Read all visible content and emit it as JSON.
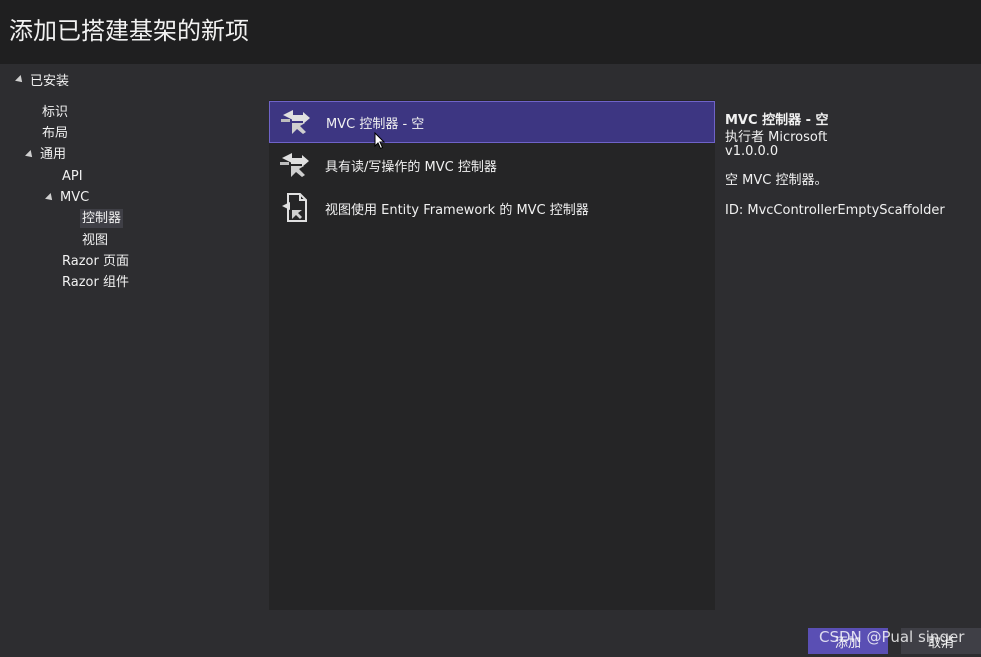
{
  "dialog": {
    "title": "添加已搭建基架的新项"
  },
  "sidebar": {
    "installed_label": "已安装",
    "items": [
      {
        "label": "标识"
      },
      {
        "label": "布局"
      },
      {
        "label": "通用"
      },
      {
        "label": "API"
      },
      {
        "label": "MVC"
      },
      {
        "label": "控制器"
      },
      {
        "label": "视图"
      },
      {
        "label": "Razor 页面"
      },
      {
        "label": "Razor 组件"
      }
    ]
  },
  "templates": [
    {
      "label": "MVC 控制器 - 空",
      "icon": "controller-icon"
    },
    {
      "label": "具有读/写操作的 MVC 控制器",
      "icon": "controller-icon"
    },
    {
      "label": "视图使用 Entity Framework 的 MVC 控制器",
      "icon": "entity-framework-icon"
    }
  ],
  "details": {
    "name": "MVC 控制器 - 空",
    "author": "执行者 Microsoft",
    "version": "v1.0.0.0",
    "description": "空 MVC 控制器。",
    "id": "ID: MvcControllerEmptyScaffolder"
  },
  "footer": {
    "add_label": "添加",
    "cancel_label": "取消"
  },
  "watermark": "CSDN @Pual singer",
  "colors": {
    "selection": "#3d3682",
    "add_button": "#5a4fb4"
  }
}
